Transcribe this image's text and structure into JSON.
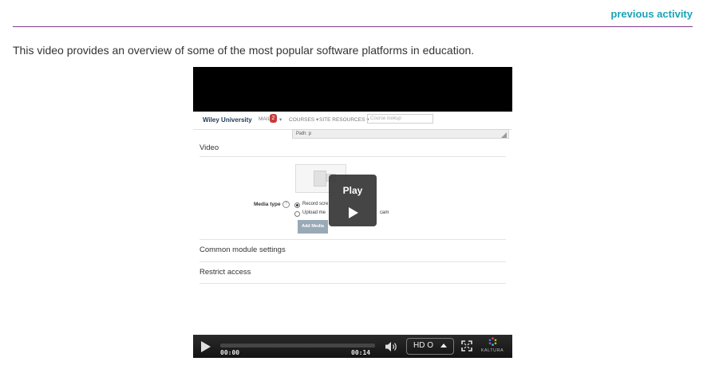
{
  "nav": {
    "previous_activity": "previous activity"
  },
  "intro_text": "This video provides an overview of some of the most popular software platforms in education.",
  "video": {
    "screen": {
      "brand": "Wiley University",
      "mail_label": "MAIL",
      "mail_count": "2",
      "courses_label": "COURSES ▾",
      "site_resources_label": "SITE RESOURCES ▾",
      "course_lookup_placeholder": "Course lookup",
      "path_label": "Path: p",
      "section_video": "Video",
      "media_type_label": "Media type",
      "option_record_screen": "Record scre",
      "option_upload": "Upload me",
      "option_upload_suffix": "cam",
      "add_media_label": "Add Media",
      "section_common": "Common module settings",
      "section_restrict": "Restrict access"
    },
    "overlay_play_label": "Play",
    "controls": {
      "current_time": "00:00",
      "duration": "00:14",
      "progress": 0,
      "quality_label": "HD O",
      "logo_text": "KALTURA"
    }
  },
  "colors": {
    "accent_link": "#1aa3b8",
    "divider": "#7b3c8c",
    "player_bg": "#000000"
  }
}
